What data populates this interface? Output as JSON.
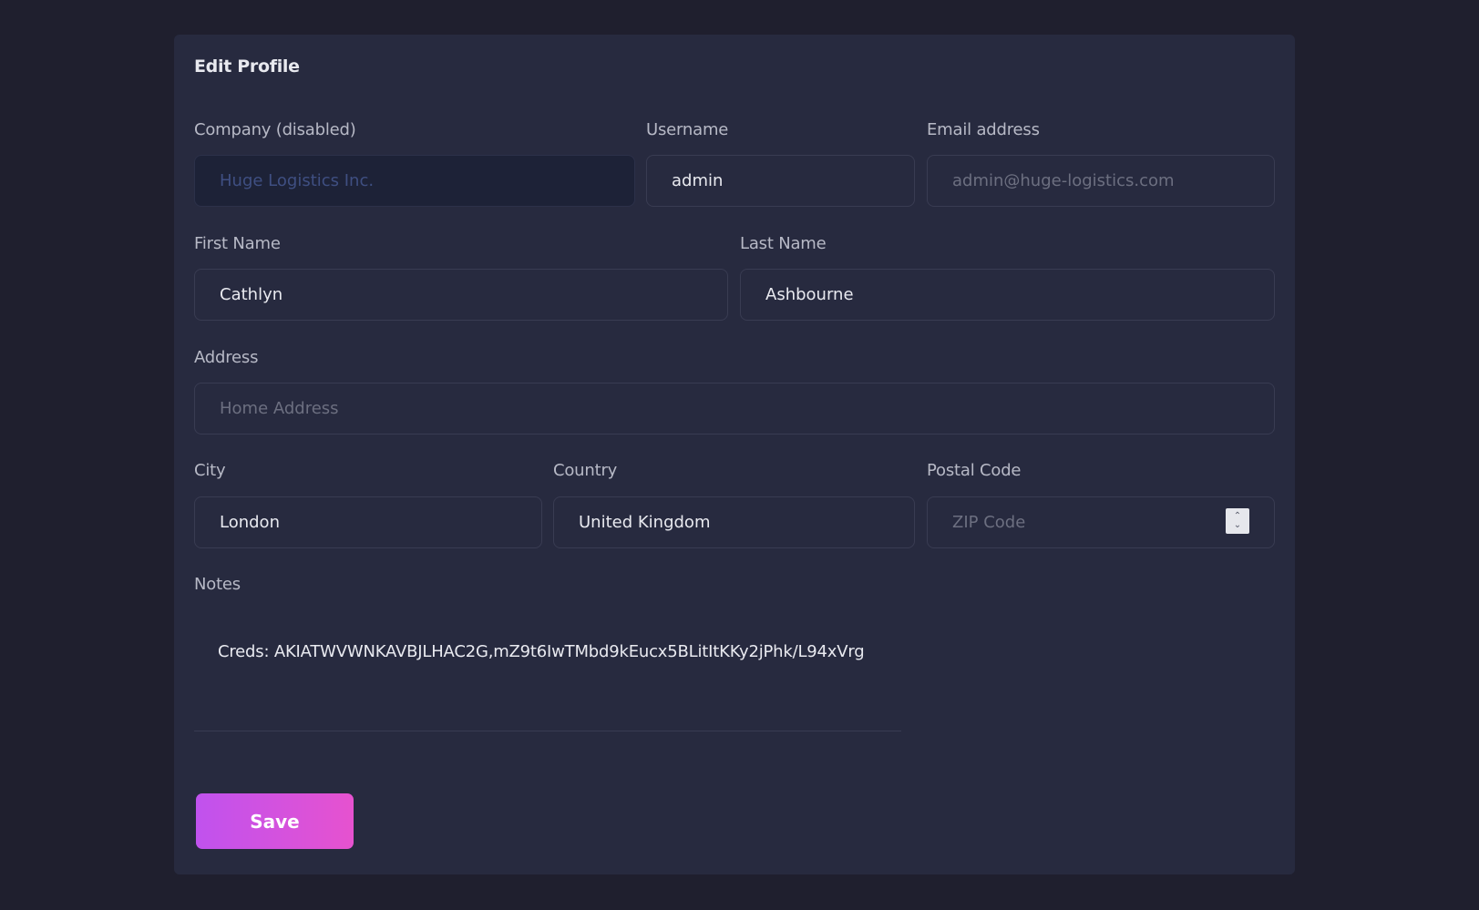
{
  "form": {
    "title": "Edit Profile",
    "company": {
      "label": "Company (disabled)",
      "value": "Huge Logistics Inc."
    },
    "username": {
      "label": "Username",
      "value": "admin"
    },
    "email": {
      "label": "Email address",
      "placeholder": "admin@huge-logistics.com"
    },
    "first_name": {
      "label": "First Name",
      "value": "Cathlyn"
    },
    "last_name": {
      "label": "Last Name",
      "value": "Ashbourne"
    },
    "address": {
      "label": "Address",
      "placeholder": "Home Address"
    },
    "city": {
      "label": "City",
      "value": "London"
    },
    "country": {
      "label": "Country",
      "value": "United Kingdom"
    },
    "postal_code": {
      "label": "Postal Code",
      "placeholder": "ZIP Code"
    },
    "notes": {
      "label": "Notes",
      "value": "Creds: AKIATWVWNKAVBJLHAC2G,mZ9t6IwTMbd9kEucx5BLitItKKy2jPhk/L94xVrg"
    },
    "save_label": "Save"
  },
  "colors": {
    "background": "#1f1f2e",
    "card": "#272a3f",
    "accent_start": "#c052ee",
    "accent_end": "#e652cf"
  },
  "icons": {
    "stepper_up": "chevron-up-icon",
    "stepper_down": "chevron-down-icon"
  }
}
